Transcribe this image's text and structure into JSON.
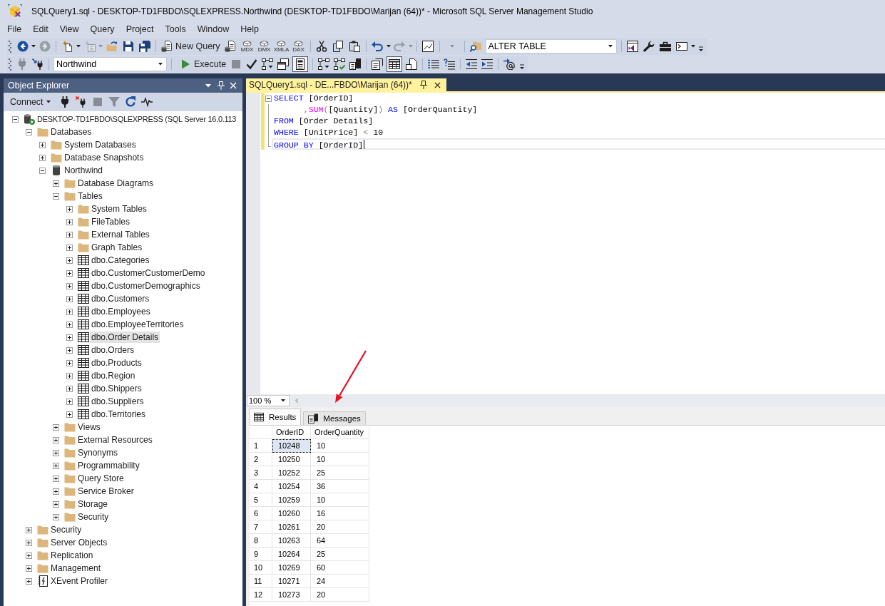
{
  "window": {
    "title": "SQLQuery1.sql - DESKTOP-TD1FBDO\\SQLEXPRESS.Northwind (DESKTOP-TD1FBDO\\Marijan (64))* - Microsoft SQL Server Management Studio"
  },
  "menu": [
    "File",
    "Edit",
    "View",
    "Query",
    "Project",
    "Tools",
    "Window",
    "Help"
  ],
  "standard_toolbar": {
    "back": {
      "disabled": false
    },
    "forward": {
      "disabled": true
    },
    "add_item": {
      "disabled": true
    },
    "new_query": {
      "label": "New Query"
    },
    "query_types": [
      {
        "label": "MDX"
      },
      {
        "label": "DMX"
      },
      {
        "label": "XMLA"
      },
      {
        "label": "DAX"
      }
    ],
    "undo": {
      "disabled": false
    },
    "redo": {
      "disabled": true
    },
    "blank_dropdown": {
      "disabled": true
    },
    "configuration": {
      "value": "ALTER TABLE"
    }
  },
  "sql_editor_toolbar": {
    "connect": {
      "disabled": true
    },
    "database": {
      "value": "Northwind"
    },
    "execute": {
      "label": "Execute"
    },
    "cancel": {
      "disabled": true
    },
    "form_toggle": {
      "pressed": true
    },
    "grid_toggle": {
      "pressed": true
    }
  },
  "object_explorer": {
    "title": "Object Explorer",
    "toolbar": {
      "connect": {
        "label": "Connect"
      },
      "stop": {
        "disabled": true
      },
      "filter": {
        "disabled": true
      }
    },
    "tree": [
      {
        "label": "DESKTOP-TD1FBDO\\SQLEXPRESS (SQL Server 16.0.113",
        "kind": "server",
        "expanded": true,
        "selected": false,
        "children": [
          {
            "label": "Databases",
            "kind": "folder",
            "expanded": true,
            "selected": false,
            "children": [
              {
                "label": "System Databases",
                "kind": "folder",
                "expanded": false,
                "selected": false
              },
              {
                "label": "Database Snapshots",
                "kind": "folder",
                "expanded": false,
                "selected": false
              },
              {
                "label": "Northwind",
                "kind": "database",
                "expanded": true,
                "selected": false,
                "children": [
                  {
                    "label": "Database Diagrams",
                    "kind": "folder",
                    "expanded": false,
                    "selected": false
                  },
                  {
                    "label": "Tables",
                    "kind": "folder",
                    "expanded": true,
                    "selected": false,
                    "children": [
                      {
                        "label": "System Tables",
                        "kind": "folder",
                        "expanded": false,
                        "selected": false
                      },
                      {
                        "label": "FileTables",
                        "kind": "folder",
                        "expanded": false,
                        "selected": false
                      },
                      {
                        "label": "External Tables",
                        "kind": "folder",
                        "expanded": false,
                        "selected": false
                      },
                      {
                        "label": "Graph Tables",
                        "kind": "folder",
                        "expanded": false,
                        "selected": false
                      },
                      {
                        "label": "dbo.Categories",
                        "kind": "table",
                        "expanded": false,
                        "selected": false
                      },
                      {
                        "label": "dbo.CustomerCustomerDemo",
                        "kind": "table",
                        "expanded": false,
                        "selected": false
                      },
                      {
                        "label": "dbo.CustomerDemographics",
                        "kind": "table",
                        "expanded": false,
                        "selected": false
                      },
                      {
                        "label": "dbo.Customers",
                        "kind": "table",
                        "expanded": false,
                        "selected": false
                      },
                      {
                        "label": "dbo.Employees",
                        "kind": "table",
                        "expanded": false,
                        "selected": false
                      },
                      {
                        "label": "dbo.EmployeeTerritories",
                        "kind": "table",
                        "expanded": false,
                        "selected": false
                      },
                      {
                        "label": "dbo.Order Details",
                        "kind": "table",
                        "expanded": false,
                        "selected": true
                      },
                      {
                        "label": "dbo.Orders",
                        "kind": "table",
                        "expanded": false,
                        "selected": false
                      },
                      {
                        "label": "dbo.Products",
                        "kind": "table",
                        "expanded": false,
                        "selected": false
                      },
                      {
                        "label": "dbo.Region",
                        "kind": "table",
                        "expanded": false,
                        "selected": false
                      },
                      {
                        "label": "dbo.Shippers",
                        "kind": "table",
                        "expanded": false,
                        "selected": false
                      },
                      {
                        "label": "dbo.Suppliers",
                        "kind": "table",
                        "expanded": false,
                        "selected": false
                      },
                      {
                        "label": "dbo.Territories",
                        "kind": "table",
                        "expanded": false,
                        "selected": false
                      }
                    ]
                  },
                  {
                    "label": "Views",
                    "kind": "folder",
                    "expanded": false,
                    "selected": false
                  },
                  {
                    "label": "External Resources",
                    "kind": "folder",
                    "expanded": false,
                    "selected": false
                  },
                  {
                    "label": "Synonyms",
                    "kind": "folder",
                    "expanded": false,
                    "selected": false
                  },
                  {
                    "label": "Programmability",
                    "kind": "folder",
                    "expanded": false,
                    "selected": false
                  },
                  {
                    "label": "Query Store",
                    "kind": "folder",
                    "expanded": false,
                    "selected": false
                  },
                  {
                    "label": "Service Broker",
                    "kind": "folder",
                    "expanded": false,
                    "selected": false
                  },
                  {
                    "label": "Storage",
                    "kind": "folder",
                    "expanded": false,
                    "selected": false
                  },
                  {
                    "label": "Security",
                    "kind": "folder",
                    "expanded": false,
                    "selected": false
                  }
                ]
              }
            ]
          },
          {
            "label": "Security",
            "kind": "folder",
            "expanded": false,
            "selected": false
          },
          {
            "label": "Server Objects",
            "kind": "folder",
            "expanded": false,
            "selected": false
          },
          {
            "label": "Replication",
            "kind": "folder",
            "expanded": false,
            "selected": false
          },
          {
            "label": "Management",
            "kind": "folder",
            "expanded": false,
            "selected": false
          },
          {
            "label": "XEvent Profiler",
            "kind": "profiler",
            "expanded": false,
            "selected": false
          }
        ]
      }
    ]
  },
  "editor": {
    "tab": {
      "title": "SQLQuery1.sql - DE...FBDO\\Marijan (64))*",
      "selected": true
    },
    "lines": [
      {
        "modified": true,
        "current": false,
        "fold_start": true,
        "tokens": [
          {
            "text": "SELECT",
            "kind": "keyword"
          },
          {
            "text": " [OrderID]",
            "kind": "plain"
          }
        ]
      },
      {
        "modified": true,
        "current": false,
        "fold_start": false,
        "tokens": [
          {
            "text": "      ,",
            "kind": "operator"
          },
          {
            "text": "SUM",
            "kind": "function"
          },
          {
            "text": "(",
            "kind": "operator"
          },
          {
            "text": "[Quantity]",
            "kind": "plain"
          },
          {
            "text": ")",
            "kind": "operator"
          },
          {
            "text": " AS ",
            "kind": "keyword"
          },
          {
            "text": "[OrderQuantity]",
            "kind": "plain"
          }
        ]
      },
      {
        "modified": true,
        "current": false,
        "fold_start": false,
        "tokens": [
          {
            "text": "FROM",
            "kind": "keyword"
          },
          {
            "text": " [Order Details]",
            "kind": "plain"
          }
        ]
      },
      {
        "modified": true,
        "current": false,
        "fold_start": false,
        "tokens": [
          {
            "text": "WHERE",
            "kind": "keyword"
          },
          {
            "text": " [UnitPrice] ",
            "kind": "plain"
          },
          {
            "text": "<",
            "kind": "operator"
          },
          {
            "text": " 10",
            "kind": "plain"
          }
        ]
      },
      {
        "modified": true,
        "current": true,
        "fold_start": false,
        "tokens": [
          {
            "text": "GROUP BY",
            "kind": "keyword"
          },
          {
            "text": " [OrderID]",
            "kind": "plain"
          }
        ]
      }
    ],
    "zoom": "100 %"
  },
  "results": {
    "tabs": [
      {
        "label": "Results",
        "selected": true
      },
      {
        "label": "Messages",
        "selected": false
      }
    ],
    "columns": [
      "OrderID",
      "OrderQuantity"
    ],
    "rows": [
      {
        "number": "1",
        "cells": [
          {
            "text": "10248",
            "selected": true
          },
          {
            "text": "10",
            "selected": false
          }
        ]
      },
      {
        "number": "2",
        "cells": [
          {
            "text": "10250",
            "selected": false
          },
          {
            "text": "10",
            "selected": false
          }
        ]
      },
      {
        "number": "3",
        "cells": [
          {
            "text": "10252",
            "selected": false
          },
          {
            "text": "25",
            "selected": false
          }
        ]
      },
      {
        "number": "4",
        "cells": [
          {
            "text": "10254",
            "selected": false
          },
          {
            "text": "36",
            "selected": false
          }
        ]
      },
      {
        "number": "5",
        "cells": [
          {
            "text": "10259",
            "selected": false
          },
          {
            "text": "10",
            "selected": false
          }
        ]
      },
      {
        "number": "6",
        "cells": [
          {
            "text": "10260",
            "selected": false
          },
          {
            "text": "16",
            "selected": false
          }
        ]
      },
      {
        "number": "7",
        "cells": [
          {
            "text": "10261",
            "selected": false
          },
          {
            "text": "20",
            "selected": false
          }
        ]
      },
      {
        "number": "8",
        "cells": [
          {
            "text": "10263",
            "selected": false
          },
          {
            "text": "64",
            "selected": false
          }
        ]
      },
      {
        "number": "9",
        "cells": [
          {
            "text": "10264",
            "selected": false
          },
          {
            "text": "25",
            "selected": false
          }
        ]
      },
      {
        "number": "10",
        "cells": [
          {
            "text": "10269",
            "selected": false
          },
          {
            "text": "60",
            "selected": false
          }
        ]
      },
      {
        "number": "11",
        "cells": [
          {
            "text": "10271",
            "selected": false
          },
          {
            "text": "24",
            "selected": false
          }
        ]
      },
      {
        "number": "12",
        "cells": [
          {
            "text": "10273",
            "selected": false
          },
          {
            "text": "20",
            "selected": false
          }
        ]
      }
    ]
  }
}
